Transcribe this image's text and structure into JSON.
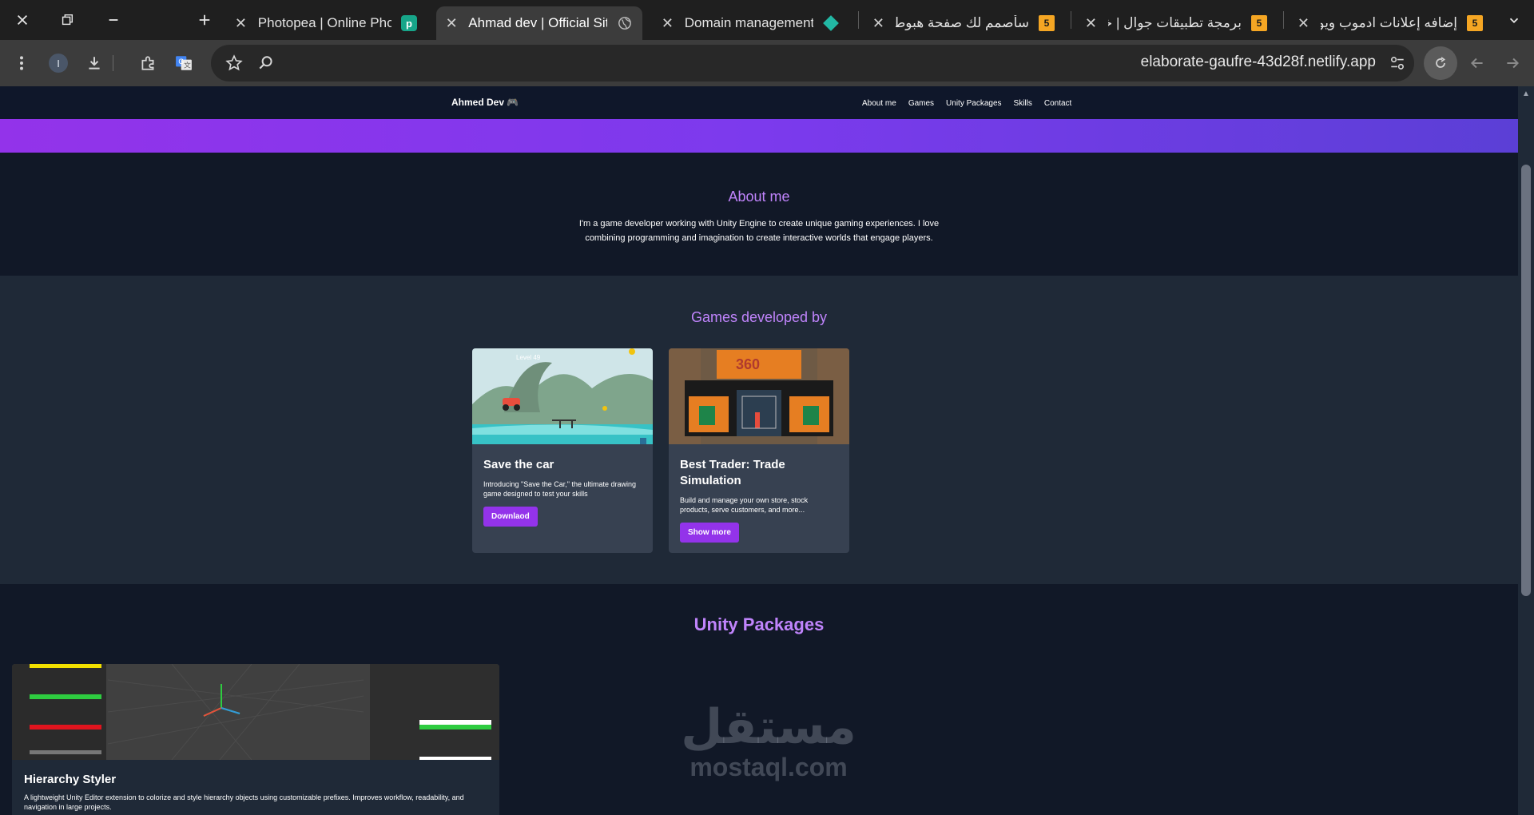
{
  "browser": {
    "tabs": [
      {
        "title": "إضافه إعلانات ادموب ويونتي",
        "favicon": "five-icon"
      },
      {
        "title": "برمجة تطبيقات جوال | خدمات",
        "favicon": "five-icon"
      },
      {
        "title": "سأصمم لك صفحة هبوط احتر",
        "favicon": "five-icon"
      },
      {
        "title": "Domain management | elab",
        "favicon": "gem-icon"
      },
      {
        "title": "Ahmad dev | Official Site",
        "favicon": "globe-icon",
        "active": true
      },
      {
        "title": "Photopea | Online Photo E",
        "favicon": "photopea-icon"
      }
    ],
    "favicon_badge": "5",
    "profile_initial": "I",
    "url": "elaborate-gaufre-43d28f.netlify.app"
  },
  "site": {
    "logo": "Ahmed Dev",
    "logo_emoji": "🎮",
    "nav": [
      "About me",
      "Games",
      "Unity Packages",
      "Skills",
      "Contact"
    ],
    "about": {
      "title": "About me",
      "text": "I'm a game developer working with Unity Engine to create unique gaming experiences. I love combining programming and imagination to create interactive worlds that engage players."
    },
    "games": {
      "title": "Games developed by",
      "cards": [
        {
          "title": "Save the car",
          "desc": "Introducing \"Save the Car,\" the ultimate drawing game designed to test your skills",
          "button": "Downlaod",
          "thumb_label": "Level 49"
        },
        {
          "title": "Best Trader: Trade Simulation",
          "desc": "Build and manage your own store, stock products, serve customers, and more...",
          "button": "Show more",
          "thumb_label": "360"
        }
      ]
    },
    "unity": {
      "title": "Unity Packages",
      "card": {
        "title": "Hierarchy Styler",
        "desc": "A lightweight Unity Editor extension to colorize and style hierarchy objects using customizable prefixes. Improves workflow, readability, and navigation in large projects."
      }
    }
  },
  "watermark": {
    "arabic": "مستقل",
    "latin": "mostaql.com"
  },
  "colors": {
    "accent": "#9333ea",
    "heading": "#c084fc",
    "bg": "#111827"
  }
}
